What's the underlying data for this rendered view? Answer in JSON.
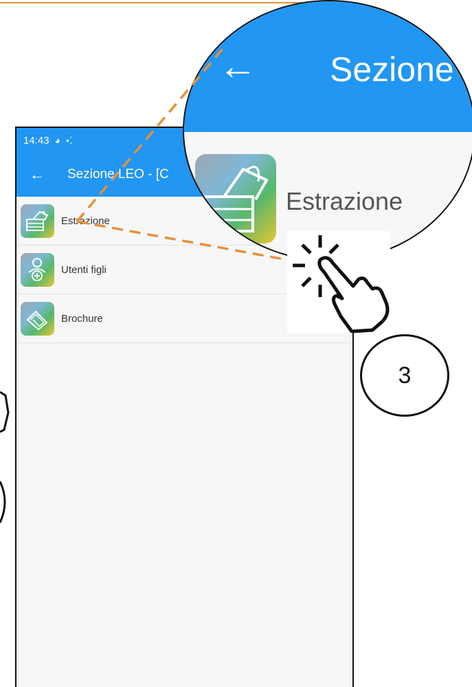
{
  "status_bar": {
    "time": "14:43"
  },
  "app_bar": {
    "back_glyph": "←",
    "title": "Sezione LEO - [C"
  },
  "list": [
    {
      "label": "Estrazione",
      "icon": "printer-icon"
    },
    {
      "label": "Utenti figli",
      "icon": "user-add-icon"
    },
    {
      "label": "Brochure",
      "icon": "brochure-icon"
    }
  ],
  "zoom": {
    "back_glyph": "←",
    "title": "Sezione",
    "item_label": "Estrazione"
  },
  "step": {
    "number": "3"
  },
  "colors": {
    "accent": "#2196f3",
    "callout_line": "#e5913a",
    "frame": "#111111"
  }
}
